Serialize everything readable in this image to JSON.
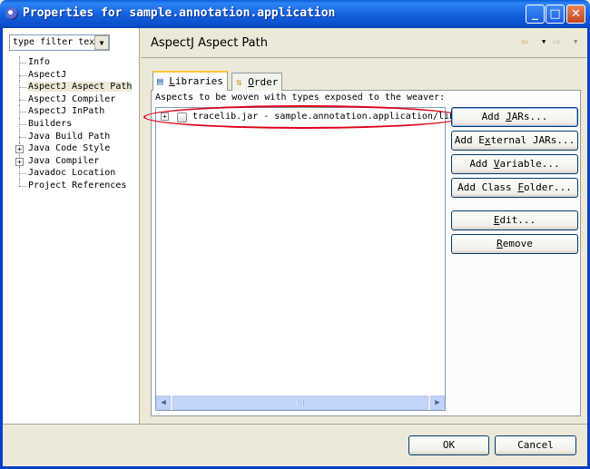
{
  "window": {
    "title": "Properties for sample.annotation.application",
    "minimize_icon": "minimize-icon",
    "maximize_icon": "maximize-icon",
    "close_icon": "close-icon"
  },
  "sidebar": {
    "filter_placeholder": "type filter tex",
    "items": [
      {
        "label": "Info",
        "expandable": false
      },
      {
        "label": "AspectJ",
        "expandable": false
      },
      {
        "label": "AspectJ Aspect Path",
        "expandable": false,
        "selected": true
      },
      {
        "label": "AspectJ Compiler",
        "expandable": false
      },
      {
        "label": "AspectJ InPath",
        "expandable": false
      },
      {
        "label": "Builders",
        "expandable": false
      },
      {
        "label": "Java Build Path",
        "expandable": false
      },
      {
        "label": "Java Code Style",
        "expandable": true
      },
      {
        "label": "Java Compiler",
        "expandable": true
      },
      {
        "label": "Javadoc Location",
        "expandable": false
      },
      {
        "label": "Project References",
        "expandable": false
      }
    ]
  },
  "main": {
    "page_title": "AspectJ Aspect Path",
    "tabs": [
      {
        "label_pre": "",
        "label_u": "L",
        "label_post": "ibraries",
        "active": true
      },
      {
        "label_pre": "",
        "label_u": "O",
        "label_post": "rder",
        "active": false
      }
    ],
    "description": "Aspects to be woven with types exposed to the weaver:",
    "entries": [
      {
        "label": "tracelib.jar - sample.annotation.application/lib"
      }
    ],
    "buttons": [
      {
        "pre": "Add ",
        "u": "J",
        "post": "ARs..."
      },
      {
        "pre": "Add E",
        "u": "x",
        "post": "ternal JARs..."
      },
      {
        "pre": "Add ",
        "u": "V",
        "post": "ariable..."
      },
      {
        "pre": "Add Class ",
        "u": "F",
        "post": "older..."
      },
      {
        "pre": "",
        "u": "E",
        "post": "dit..."
      },
      {
        "pre": "",
        "u": "R",
        "post": "emove"
      }
    ]
  },
  "footer": {
    "ok_label": "OK",
    "cancel_label": "Cancel"
  },
  "colors": {
    "titlebar": "#1662E0",
    "annotation": "#E0001A"
  }
}
